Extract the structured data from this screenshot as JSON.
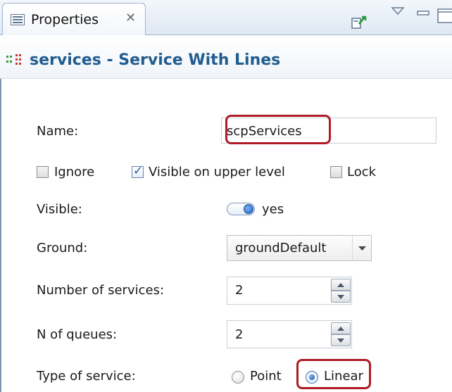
{
  "tab": {
    "label": "Properties",
    "close_glyph": "✕"
  },
  "toolbar": {
    "icons": [
      "pin-icon",
      "view-menu-icon",
      "minimize-icon",
      "maximize-icon"
    ]
  },
  "header": {
    "title": "services - Service With Lines",
    "icon": "service-block-icon"
  },
  "form": {
    "name_label": "Name:",
    "name_value": "scpServices",
    "ignore_label": "Ignore",
    "ignore_checked": false,
    "visible_upper_label": "Visible on upper level",
    "visible_upper_checked": true,
    "lock_label": "Lock",
    "lock_checked": false,
    "visible_label": "Visible:",
    "visible_value": "yes",
    "ground_label": "Ground:",
    "ground_value": "groundDefault",
    "num_services_label": "Number of services:",
    "num_services_value": "2",
    "n_queues_label": "N of queues:",
    "n_queues_value": "2",
    "type_label": "Type of service:",
    "type_options": [
      "Point",
      "Linear"
    ],
    "type_selected": "Linear"
  },
  "highlight_color": "#b01b27",
  "accent_color": "#215c8f"
}
